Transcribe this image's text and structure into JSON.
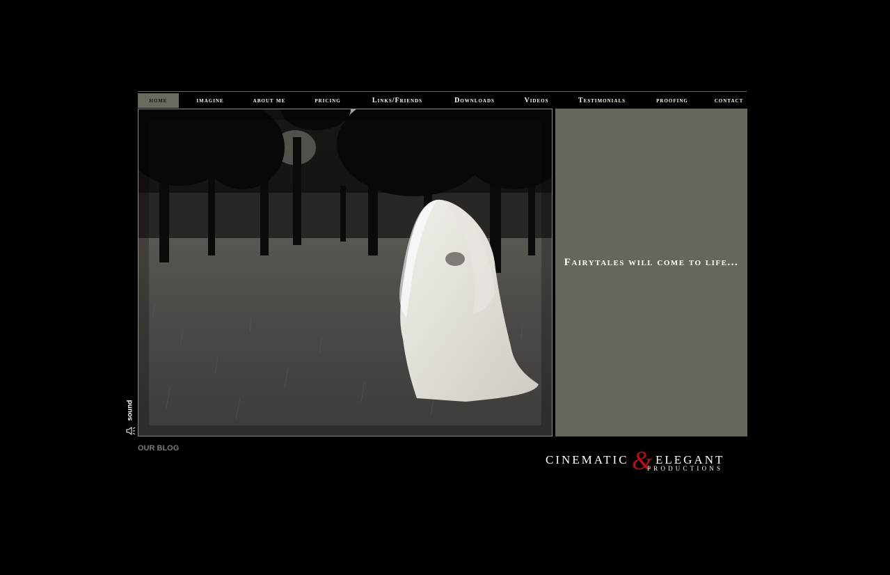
{
  "nav": {
    "items": [
      {
        "label": "home",
        "active": true
      },
      {
        "label": "imagine",
        "active": false
      },
      {
        "label": "about me",
        "active": false
      },
      {
        "label": "pricing",
        "active": false
      },
      {
        "label": "Links/Friends",
        "active": false
      },
      {
        "label": "Downloads",
        "active": false
      },
      {
        "label": "Videos",
        "active": false
      },
      {
        "label": "Testimonials",
        "active": false
      },
      {
        "label": "proofing",
        "active": false
      },
      {
        "label": "contact",
        "active": false
      }
    ]
  },
  "panel": {
    "tagline": "Fairytales will come to life..."
  },
  "sound": {
    "label": "sound"
  },
  "footer": {
    "blog_label": "OUR BLOG"
  },
  "logo": {
    "word1": "CINEMATIC",
    "ampersand": "&",
    "word2": "ELEGANT",
    "word3": "PRODUCTIONS"
  },
  "colors": {
    "background": "#000000",
    "panel": "#66675a",
    "nav_active": "#6a6a5e",
    "ampersand": "#b0111a"
  }
}
